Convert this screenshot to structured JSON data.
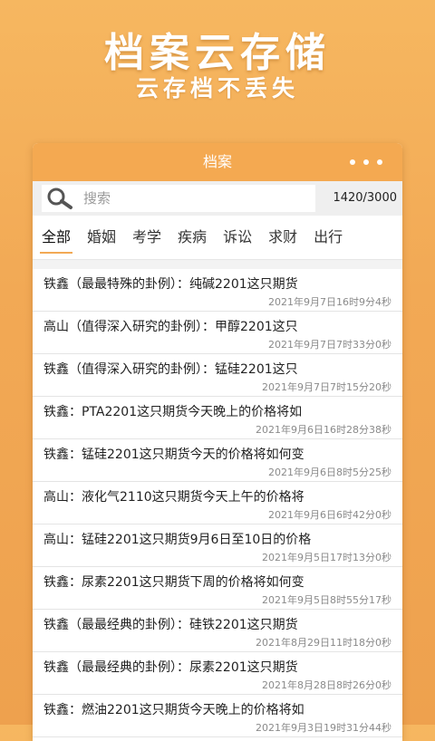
{
  "hero": {
    "title": "档案云存储",
    "subtitle": "云存档不丢失"
  },
  "header": {
    "title": "档案",
    "more_icon": "more-dots-icon"
  },
  "search": {
    "placeholder": "搜索",
    "count": "1420/3000",
    "icon": "search-icon"
  },
  "tabs": [
    {
      "label": "全部",
      "active": true
    },
    {
      "label": "婚姻"
    },
    {
      "label": "考学"
    },
    {
      "label": "疾病"
    },
    {
      "label": "诉讼"
    },
    {
      "label": "求财"
    },
    {
      "label": "出行"
    }
  ],
  "records": [
    {
      "title": "铁鑫（最最特殊的卦例）：纯碱2201这只期货",
      "time": "2021年9月7日16时9分4秒"
    },
    {
      "title": "高山（值得深入研究的卦例）：甲醇2201这只",
      "time": "2021年9月7日7时33分0秒"
    },
    {
      "title": "铁鑫（值得深入研究的卦例）：锰硅2201这只",
      "time": "2021年9月7日7时15分20秒"
    },
    {
      "title": "铁鑫：PTA2201这只期货今天晚上的价格将如",
      "time": "2021年9月6日16时28分38秒"
    },
    {
      "title": "铁鑫：锰硅2201这只期货今天的价格将如何变",
      "time": "2021年9月6日8时5分25秒"
    },
    {
      "title": "高山：液化气2110这只期货今天上午的价格将",
      "time": "2021年9月6日6时42分0秒"
    },
    {
      "title": "高山：锰硅2201这只期货9月6日至10日的价格",
      "time": "2021年9月5日17时13分0秒"
    },
    {
      "title": "铁鑫：尿素2201这只期货下周的价格将如何变",
      "time": "2021年9月5日8时55分17秒"
    },
    {
      "title": "铁鑫（最最经典的卦例）：硅铁2201这只期货",
      "time": "2021年8月29日11时18分0秒"
    },
    {
      "title": "铁鑫（最最经典的卦例）：尿素2201这只期货",
      "time": "2021年8月28日8时26分0秒"
    },
    {
      "title": "铁鑫：燃油2201这只期货今天晚上的价格将如",
      "time": "2021年9月3日19时31分44秒"
    }
  ]
}
